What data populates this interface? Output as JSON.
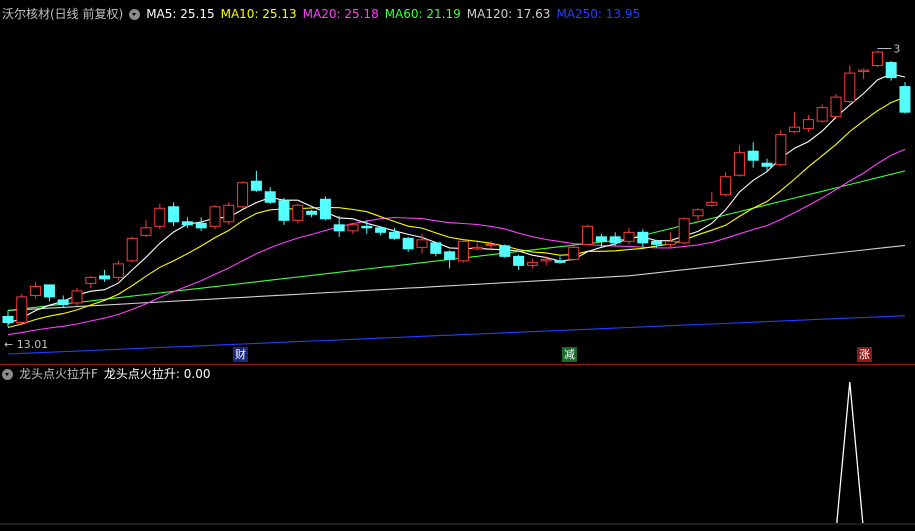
{
  "main_header": {
    "title": "沃尔核材(日线 前复权)",
    "ma": [
      {
        "label": "MA5: 25.15",
        "color": "#ffffff"
      },
      {
        "label": "MA10: 25.13",
        "color": "#ffff00"
      },
      {
        "label": "MA20: 25.18",
        "color": "#ff40ff"
      },
      {
        "label": "MA60: 21.19",
        "color": "#40ff40"
      },
      {
        "label": "MA120: 17.63",
        "color": "#d0d0d0"
      },
      {
        "label": "MA250: 13.95",
        "color": "#2040ff"
      }
    ]
  },
  "indicator_header": {
    "name": "龙头点火拉升F",
    "value_label": "龙头点火拉升: 0.00"
  },
  "annotations": {
    "low_label": "13.01",
    "high_label": "3"
  },
  "events": [
    {
      "label": "财",
      "bg": "#1a2a7a"
    },
    {
      "label": "减",
      "bg": "#1a6a2a"
    },
    {
      "label": "涨",
      "bg": "#8a1a1a"
    }
  ],
  "colors": {
    "up": "#ff3a3a",
    "down": "#54ffff",
    "grid": "#9a1a1a",
    "indicator": "#ffffff"
  },
  "chart_data": {
    "type": "candlestick",
    "ohlc": [
      [
        13.9,
        14.3,
        13.2,
        13.5
      ],
      [
        13.5,
        15.4,
        13.4,
        15.2
      ],
      [
        15.3,
        16.2,
        15.1,
        15.9
      ],
      [
        16.0,
        16.0,
        14.9,
        15.2
      ],
      [
        15.0,
        15.3,
        14.5,
        14.7
      ],
      [
        14.8,
        15.8,
        14.6,
        15.6
      ],
      [
        16.1,
        16.6,
        15.8,
        16.5
      ],
      [
        16.6,
        17.0,
        16.2,
        16.4
      ],
      [
        16.5,
        17.6,
        16.3,
        17.4
      ],
      [
        17.6,
        19.2,
        17.5,
        19.1
      ],
      [
        19.3,
        20.3,
        19.2,
        19.8
      ],
      [
        19.9,
        21.4,
        19.7,
        21.1
      ],
      [
        21.2,
        21.5,
        19.9,
        20.2
      ],
      [
        20.2,
        20.5,
        19.8,
        20.0
      ],
      [
        20.1,
        20.5,
        19.6,
        19.8
      ],
      [
        19.9,
        21.3,
        19.7,
        21.2
      ],
      [
        20.2,
        21.5,
        20.0,
        21.3
      ],
      [
        21.2,
        22.9,
        21.1,
        22.8
      ],
      [
        22.9,
        23.6,
        22.2,
        22.3
      ],
      [
        22.2,
        22.5,
        21.4,
        21.5
      ],
      [
        21.6,
        21.8,
        20.0,
        20.3
      ],
      [
        20.3,
        21.4,
        20.1,
        21.3
      ],
      [
        20.9,
        21.0,
        20.5,
        20.7
      ],
      [
        21.7,
        21.9,
        20.3,
        20.4
      ],
      [
        20.0,
        20.6,
        19.2,
        19.6
      ],
      [
        19.6,
        20.1,
        19.4,
        20.0
      ],
      [
        19.9,
        20.3,
        19.4,
        19.8
      ],
      [
        19.8,
        19.9,
        19.3,
        19.5
      ],
      [
        19.5,
        19.8,
        19.0,
        19.1
      ],
      [
        19.1,
        19.2,
        18.2,
        18.4
      ],
      [
        18.5,
        19.4,
        18.1,
        19.0
      ],
      [
        18.8,
        18.8,
        17.9,
        18.1
      ],
      [
        18.2,
        18.3,
        17.1,
        17.7
      ],
      [
        17.6,
        19.0,
        17.5,
        18.9
      ],
      [
        18.4,
        18.8,
        18.3,
        18.5
      ],
      [
        18.7,
        18.9,
        18.4,
        18.7
      ],
      [
        18.6,
        18.7,
        17.8,
        17.9
      ],
      [
        17.9,
        18.0,
        17.0,
        17.3
      ],
      [
        17.3,
        17.7,
        17.1,
        17.5
      ],
      [
        17.6,
        17.9,
        17.3,
        17.7
      ],
      [
        17.6,
        17.9,
        17.4,
        17.5
      ],
      [
        17.7,
        18.7,
        17.6,
        18.5
      ],
      [
        18.7,
        20.0,
        18.6,
        19.9
      ],
      [
        19.2,
        19.4,
        18.5,
        18.9
      ],
      [
        19.2,
        19.5,
        18.6,
        18.8
      ],
      [
        18.9,
        19.8,
        18.7,
        19.5
      ],
      [
        19.5,
        19.7,
        18.5,
        18.8
      ],
      [
        18.9,
        19.0,
        18.5,
        18.7
      ],
      [
        18.7,
        19.5,
        18.5,
        18.9
      ],
      [
        18.8,
        20.5,
        18.7,
        20.4
      ],
      [
        20.6,
        21.1,
        20.3,
        21.0
      ],
      [
        21.3,
        22.2,
        21.2,
        21.5
      ],
      [
        22.0,
        23.5,
        21.9,
        23.2
      ],
      [
        23.3,
        25.3,
        23.2,
        24.8
      ],
      [
        24.9,
        25.5,
        23.8,
        24.3
      ],
      [
        24.1,
        24.4,
        23.6,
        23.9
      ],
      [
        24.0,
        26.3,
        23.9,
        26.0
      ],
      [
        26.2,
        27.5,
        26.1,
        26.5
      ],
      [
        26.4,
        27.3,
        26.2,
        27.0
      ],
      [
        26.9,
        28.0,
        26.8,
        27.8
      ],
      [
        27.2,
        28.7,
        27.1,
        28.5
      ],
      [
        28.2,
        30.6,
        28.1,
        30.1
      ],
      [
        30.2,
        30.4,
        29.7,
        30.3
      ],
      [
        30.6,
        31.6,
        30.5,
        31.5
      ],
      [
        30.8,
        30.9,
        29.6,
        29.8
      ],
      [
        29.2,
        29.5,
        27.4,
        27.5
      ]
    ],
    "ma_values": {
      "MA5": 25.15,
      "MA10": 25.13,
      "MA20": 25.18,
      "MA60": 21.19,
      "MA120": 17.63,
      "MA250": 13.95
    },
    "indicator": {
      "name": "龙头点火拉升",
      "signal_index": 61,
      "signal_value": 1
    }
  }
}
